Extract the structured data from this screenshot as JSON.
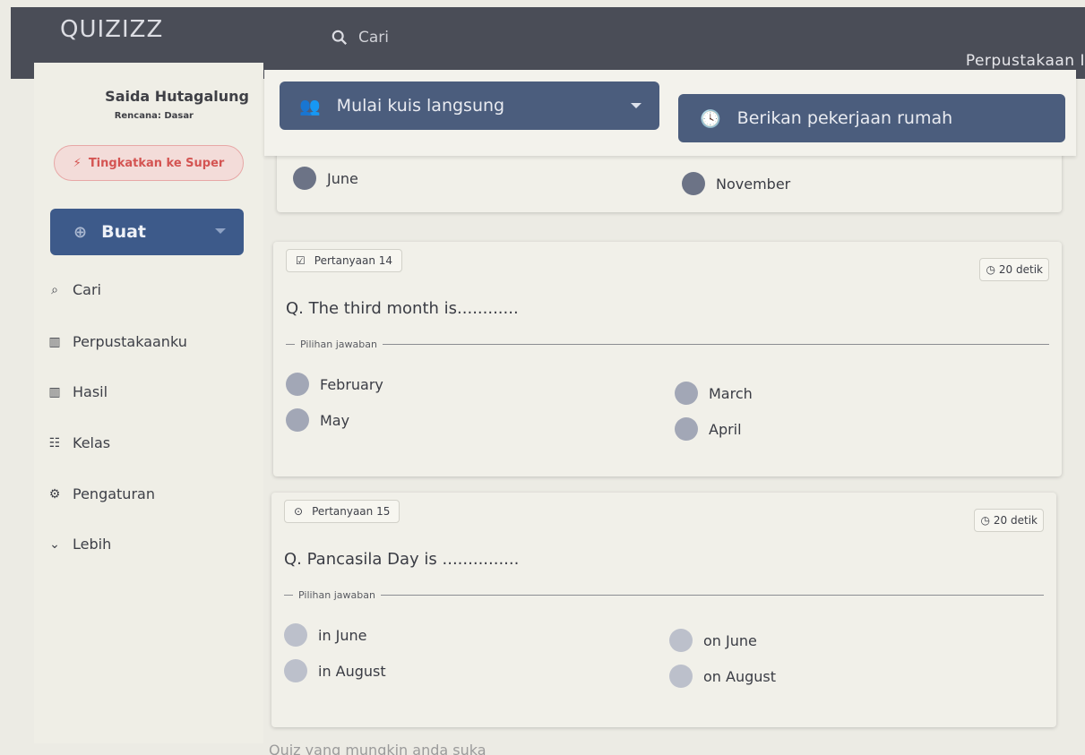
{
  "header": {
    "logo": "QUIZIZZ",
    "search_placeholder": "Cari",
    "library_link": "Perpustakaan I"
  },
  "sidebar": {
    "user_name": "Saida Hutagalung",
    "plan": "Rencana: Dasar",
    "upgrade_label": "Tingkatkan ke Super",
    "create_label": "Buat",
    "items": [
      {
        "label": "Cari",
        "icon": "search-icon"
      },
      {
        "label": "Perpustakaanku",
        "icon": "library-icon"
      },
      {
        "label": "Hasil",
        "icon": "results-icon"
      },
      {
        "label": "Kelas",
        "icon": "class-icon"
      },
      {
        "label": "Pengaturan",
        "icon": "settings-icon"
      },
      {
        "label": "Lebih",
        "icon": "chevron-down-icon"
      }
    ]
  },
  "actions": {
    "live_quiz": "Mulai kuis langsung",
    "homework": "Berikan pekerjaan rumah"
  },
  "prev_question": {
    "options": [
      "June",
      "November"
    ]
  },
  "questions": [
    {
      "badge": "Pertanyaan 14",
      "timer": "20 detik",
      "text": "Q. The third month is............",
      "choices_label": "Pilihan jawaban",
      "options": [
        "February",
        "March",
        "May",
        "April"
      ]
    },
    {
      "badge": "Pertanyaan 15",
      "timer": "20 detik",
      "text": "Q. Pancasila Day is ...............",
      "choices_label": "Pilihan jawaban",
      "options": [
        "in June",
        "on June",
        "in August",
        "on August"
      ]
    }
  ],
  "footer": {
    "text": "Quiz yang mungkin anda suka"
  },
  "colors": {
    "topbar": "#4a4d57",
    "primary": "#3d5a8a",
    "upgrade": "#d45452"
  }
}
